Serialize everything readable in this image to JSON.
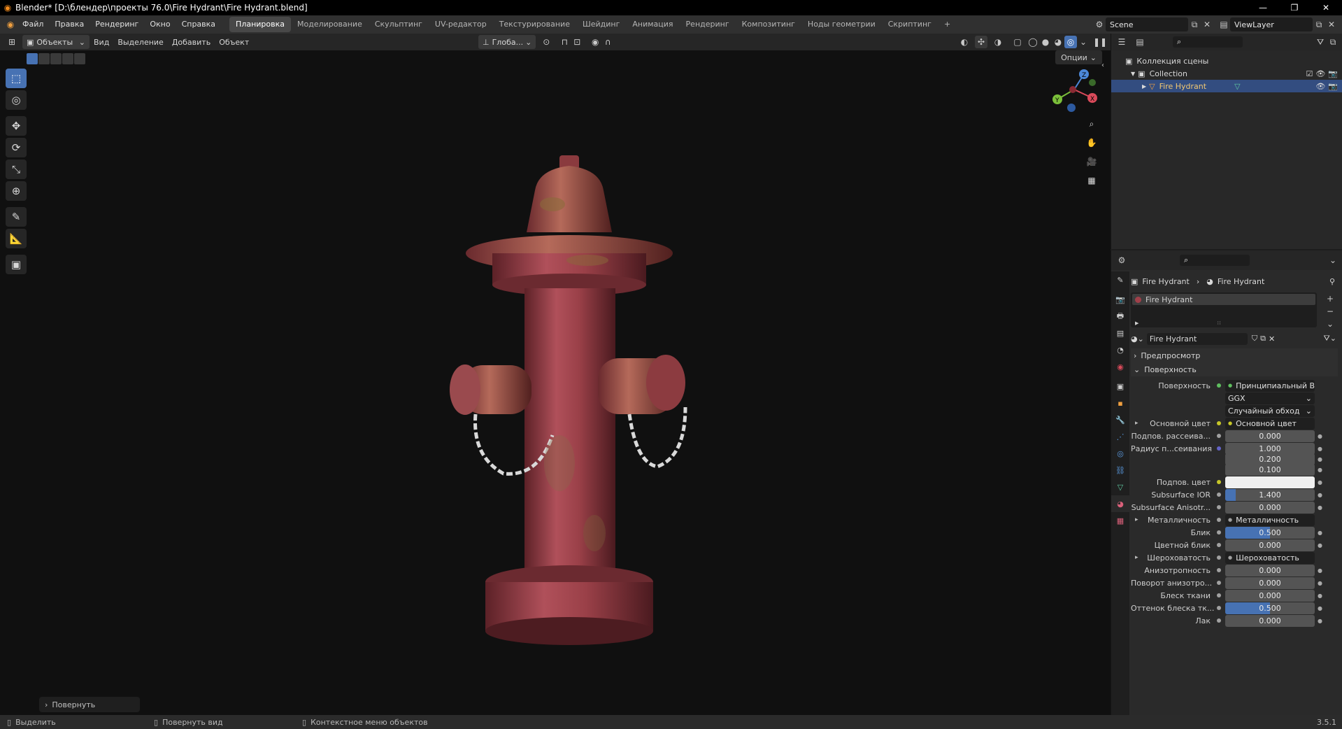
{
  "window": {
    "title": "Blender* [D:\\блендер\\проекты 76.0\\Fire Hydrant\\Fire Hydrant.blend]",
    "controls": [
      "—",
      "❐",
      "✕"
    ]
  },
  "menu": [
    "Файл",
    "Правка",
    "Рендеринг",
    "Окно",
    "Справка"
  ],
  "workspace_tabs": [
    "Планировка",
    "Моделирование",
    "Скульптинг",
    "UV-редактор",
    "Текстурирование",
    "Шейдинг",
    "Анимация",
    "Рендеринг",
    "Композитинг",
    "Ноды геометрии",
    "Скриптинг",
    "+"
  ],
  "active_workspace": "Планировка",
  "scene_name": "Scene",
  "view_layer": "ViewLayer",
  "viewport_header": {
    "mode": "Объекты",
    "menus": [
      "Вид",
      "Выделение",
      "Добавить",
      "Объект"
    ],
    "orientation": "Глоба...",
    "options": "Опции"
  },
  "toolbar_tools": [
    {
      "name": "select-box-tool",
      "glyph": "⬚",
      "active": true
    },
    {
      "name": "cursor-tool",
      "glyph": "◎",
      "active": false
    },
    {
      "name": "move-tool",
      "glyph": "✥",
      "active": false
    },
    {
      "name": "rotate-tool",
      "glyph": "⟳",
      "active": false
    },
    {
      "name": "scale-tool",
      "glyph": "⤡",
      "active": false
    },
    {
      "name": "transform-tool",
      "glyph": "⊕",
      "active": false
    },
    {
      "name": "annotate-tool",
      "glyph": "✎",
      "active": false
    },
    {
      "name": "measure-tool",
      "glyph": "📐",
      "active": false
    },
    {
      "name": "add-cube-tool",
      "glyph": "▣",
      "active": false
    }
  ],
  "gizmo": {
    "x": "X",
    "y": "Y",
    "z": "Z"
  },
  "redo_panel": "Повернуть",
  "outliner": {
    "scene_collection": "Коллекция сцены",
    "collection": "Collection",
    "object": "Fire Hydrant"
  },
  "properties": {
    "breadcrumb_object": "Fire Hydrant",
    "breadcrumb_material": "Fire Hydrant",
    "material_slot": "Fire Hydrant",
    "material_name": "Fire Hydrant",
    "panel_preview": "Предпросмотр",
    "panel_surface": "Поверхность",
    "rows": [
      {
        "label": "Поверхность",
        "kind": "link",
        "value": "Принципиальный BSDF",
        "socket": "#5fbf5f"
      },
      {
        "label": "",
        "kind": "dropdown",
        "value": "GGX"
      },
      {
        "label": "",
        "kind": "dropdown",
        "value": "Случайный обход"
      },
      {
        "label": "Основной цвет",
        "kind": "link",
        "value": "Основной цвет",
        "socket": "#c7c729",
        "expand": true
      },
      {
        "label": "Подпов. рассеива...",
        "kind": "num",
        "value": "0.000",
        "fill": 0,
        "socket": "#a1a1a1"
      },
      {
        "label": "Радиус п...сеивания",
        "kind": "num",
        "value": "1.000",
        "fill": 0,
        "socket": "#6363c7"
      },
      {
        "label": "",
        "kind": "num",
        "value": "0.200",
        "fill": 0
      },
      {
        "label": "",
        "kind": "num",
        "value": "0.100",
        "fill": 0
      },
      {
        "label": "Подпов. цвет",
        "kind": "color",
        "value": "#f0f0f0",
        "socket": "#c7c729"
      },
      {
        "label": "Subsurface IOR",
        "kind": "num",
        "value": "1.400",
        "fill": 0.12,
        "socket": "#a1a1a1"
      },
      {
        "label": "Subsurface Anisotr...",
        "kind": "num",
        "value": "0.000",
        "fill": 0,
        "socket": "#a1a1a1"
      },
      {
        "label": "Металличность",
        "kind": "link",
        "value": "Металличность",
        "socket": "#a1a1a1",
        "expand": true
      },
      {
        "label": "Блик",
        "kind": "num",
        "value": "0.500",
        "fill": 0.5,
        "socket": "#a1a1a1"
      },
      {
        "label": "Цветной блик",
        "kind": "num",
        "value": "0.000",
        "fill": 0,
        "socket": "#a1a1a1"
      },
      {
        "label": "Шероховатость",
        "kind": "link",
        "value": "Шероховатость",
        "socket": "#a1a1a1",
        "expand": true
      },
      {
        "label": "Анизотропность",
        "kind": "num",
        "value": "0.000",
        "fill": 0,
        "socket": "#a1a1a1"
      },
      {
        "label": "Поворот анизотро...",
        "kind": "num",
        "value": "0.000",
        "fill": 0,
        "socket": "#a1a1a1"
      },
      {
        "label": "Блеск ткани",
        "kind": "num",
        "value": "0.000",
        "fill": 0,
        "socket": "#a1a1a1"
      },
      {
        "label": "Оттенок блеска тк...",
        "kind": "num",
        "value": "0.500",
        "fill": 0.5,
        "socket": "#a1a1a1"
      },
      {
        "label": "Лак",
        "kind": "num",
        "value": "0.000",
        "fill": 0,
        "socket": "#a1a1a1"
      }
    ]
  },
  "statusbar": {
    "select": "Выделить",
    "rotate_view": "Повернуть вид",
    "context_menu": "Контекстное меню объектов",
    "version": "3.5.1"
  },
  "colors": {
    "accent": "#4772b3",
    "selected_row": "#334d80",
    "hydrant_red": "#a8404a"
  }
}
